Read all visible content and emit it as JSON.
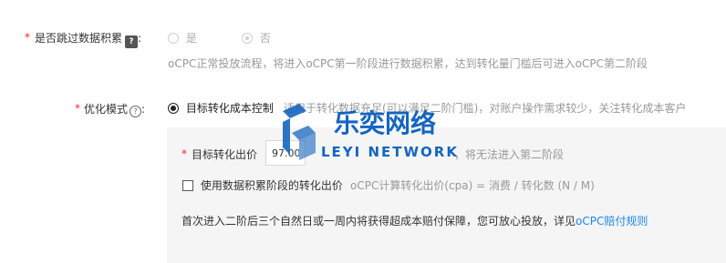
{
  "skip_accumulation": {
    "required_mark": "*",
    "label": "是否跳过数据积累",
    "help_icon": "question-box-icon",
    "option_yes": "是",
    "option_no": "否",
    "selected": "否",
    "hint": "oCPC正常投放流程，将进入oCPC第一阶段进行数据积累，达到转化量门槛后可进入oCPC第二阶段"
  },
  "optimize_mode": {
    "required_mark": "*",
    "label": "优化模式",
    "help_icon": "question-circle-icon",
    "option_label": "目标转化成本控制",
    "option_desc": "适用于转化数据充足(可以满足二阶门槛)，对账户操作需求较少，关注转化成本客户"
  },
  "target_bid": {
    "required_mark": "*",
    "label": "目标转化出价",
    "value": "97.00",
    "hint": "，将无法进入第二阶段"
  },
  "use_accum_bid": {
    "label": "使用数据积累阶段的转化出价",
    "checked": false,
    "formula": "oCPC计算转化出价(cpa) = 消费 / 转化数 (N / M)"
  },
  "guarantee": {
    "text": "首次进入二阶后三个自然日或一周内将获得超成本赔付保障，您可放心投放，详见",
    "link": "oCPC赔付规则"
  },
  "watermark": {
    "brand_cn": "乐奕网络",
    "brand_en": "LEYI NETWORK"
  },
  "colors": {
    "required": "#f5222d",
    "link": "#1e88e5",
    "watermark": "#1565c0"
  }
}
